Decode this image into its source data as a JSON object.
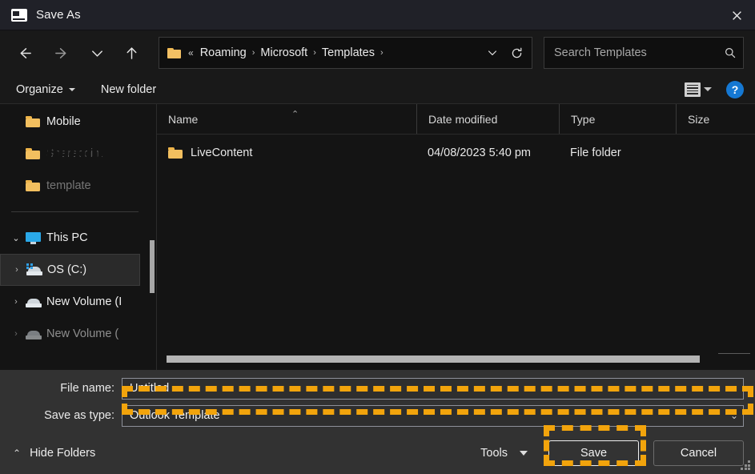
{
  "window": {
    "title": "Save As",
    "icon": "mail-template-icon",
    "close_label": "Close"
  },
  "nav": {
    "back": "Back",
    "forward": "Forward",
    "recent": "Recent locations",
    "up": "Up to Microsoft",
    "refresh": "Refresh",
    "dropdown": "Previous locations",
    "breadcrumb_prefix": "«",
    "breadcrumb": [
      "Roaming",
      "Microsoft",
      "Templates"
    ],
    "breadcrumb_separator": "›"
  },
  "search": {
    "placeholder": "Search Templates",
    "value": "",
    "icon": "search-icon"
  },
  "command_bar": {
    "organize": "Organize",
    "new_folder": "New folder",
    "view_icon": "list-view-icon",
    "help": "?"
  },
  "tree": {
    "items": [
      {
        "label": "Mobile",
        "icon": "folder-icon",
        "state": "normal",
        "indent": 1
      },
      {
        "label": "Sharepoint i",
        "icon": "folder-icon",
        "state": "ghost",
        "indent": 1
      },
      {
        "label": "template",
        "icon": "folder-icon",
        "state": "ghost2",
        "indent": 1
      },
      {
        "label": "This PC",
        "icon": "this-pc-icon",
        "state": "expanded",
        "indent": 0
      },
      {
        "label": "OS (C:)",
        "icon": "os-drive-icon",
        "state": "selected",
        "indent": 1
      },
      {
        "label": "New Volume (I",
        "icon": "drive-icon",
        "state": "normal",
        "indent": 1
      },
      {
        "label": "New Volume (",
        "icon": "drive-icon",
        "state": "clipped",
        "indent": 1
      }
    ],
    "chevron_right": "›",
    "chevron_down": "⌄"
  },
  "file_list": {
    "columns": [
      "Name",
      "Date modified",
      "Type",
      "Size"
    ],
    "sort_column": "Name",
    "sort_direction": "ascending",
    "sort_caret": "⌃",
    "rows": [
      {
        "name": "LiveContent",
        "date_modified": "04/08/2023 5:40 pm",
        "type": "File folder",
        "size": "",
        "icon": "folder-icon"
      }
    ]
  },
  "form": {
    "file_name_label": "File name:",
    "file_name_value": "Untitled",
    "save_as_type_label": "Save as type:",
    "save_as_type_value": "Outlook Template",
    "chevron": "⌄"
  },
  "footer": {
    "hide_folders": "Hide Folders",
    "hide_folders_chevron": "⌃",
    "tools": "Tools",
    "save": "Save",
    "cancel": "Cancel"
  },
  "highlights": {
    "color": "#f2a40c",
    "targets": [
      "save-as-type-combo",
      "save-button"
    ]
  }
}
